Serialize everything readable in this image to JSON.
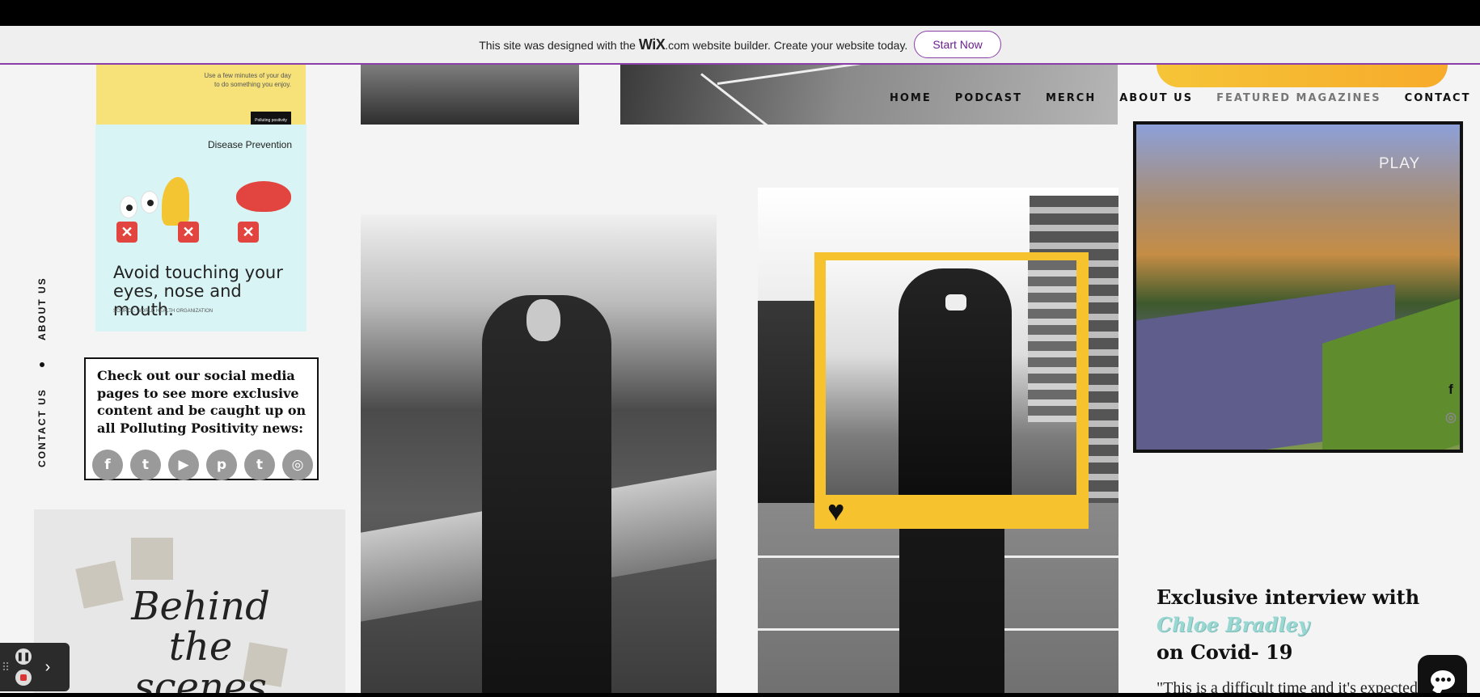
{
  "banner": {
    "message_prefix": "This site was designed with the",
    "brand": "WiX",
    "message_suffix": ".com website builder. Create your website today.",
    "cta": "Start Now"
  },
  "nav": {
    "items": [
      "HOME",
      "PODCAST",
      "MERCH",
      "ABOUT US",
      "FEATURED MAGAZINES",
      "CONTACT"
    ]
  },
  "side_nav": {
    "about": "ABOUT US",
    "contact": "CONTACT US"
  },
  "cards": {
    "yellow_text": "Use a few minutes of your day to do something you enjoy.",
    "yellow_logo": "Polluting positivity",
    "disease_title": "Disease Prevention",
    "avoid_text": "Avoid touching your eyes, nose and mouth.",
    "source": "SOURCE: WORLD HEALTH ORGANIZATION",
    "social_text": "Check out our social media pages to see more exclusive content and be caught up on all Polluting Positivity news:",
    "social_icons": [
      "f",
      "t",
      "▶",
      "p",
      "t",
      "◎"
    ],
    "behind_title": "Behind the scenes"
  },
  "video": {
    "play": "PLAY"
  },
  "interview": {
    "heading": "Exclusive interview with",
    "name": "Chloe Bradley",
    "heading_end": "on Covid- 19",
    "quote": "\"This is a difficult time and it's expected that many feel down with"
  },
  "colors": {
    "accent_yellow": "#f6c22e",
    "wix_purple": "#8a3ea8",
    "name_teal": "#98d7d2"
  }
}
